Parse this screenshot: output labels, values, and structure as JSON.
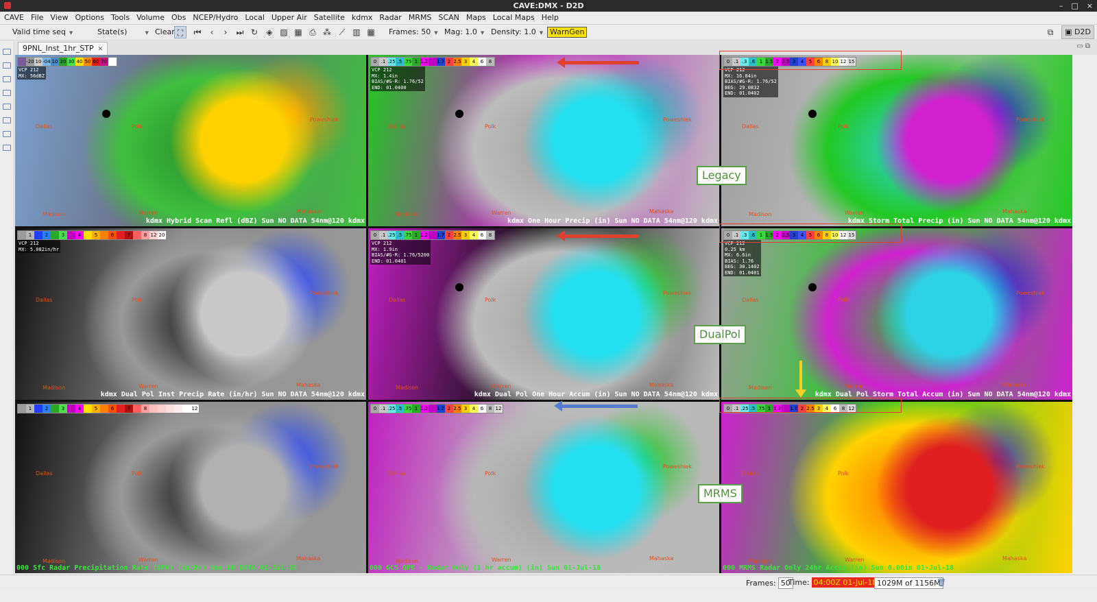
{
  "window": {
    "title": "CAVE:DMX - D2D"
  },
  "menu": [
    "CAVE",
    "File",
    "View",
    "Options",
    "Tools",
    "Volume",
    "Obs",
    "NCEP/Hydro",
    "Local",
    "Upper Air",
    "Satellite",
    "kdmx",
    "Radar",
    "MRMS",
    "SCAN",
    "Maps",
    "Local Maps",
    "Help"
  ],
  "toolbar": {
    "valid_time": "Valid time seq",
    "states": "State(s)",
    "clear": "Clear",
    "frames": "Frames: 50",
    "mag": "Mag: 1.0",
    "density": "Density: 1.0",
    "warngen": "WarnGen",
    "perspective": "D2D"
  },
  "tab": {
    "label": "9PNL_Inst_1hr_STP"
  },
  "labels": {
    "legacy": "Legacy",
    "dualpol": "DualPol",
    "mrms": "MRMS"
  },
  "panes": [
    {
      "legend": "kdmx Hybrid Scan Refl (dBZ)  Sun  NO DATA 54nm@120 kdmx",
      "info": [
        "VCP 212",
        "MX: 56dBZ"
      ],
      "ticks": [
        "",
        "-20",
        "10",
        "-04",
        "10",
        "20",
        "30",
        "40",
        "50",
        "60",
        "70",
        ""
      ],
      "colors": [
        "#7a5a9a",
        "#9a9a9a",
        "#cfcfcf",
        "#7ab6e6",
        "#4a8ac6",
        "#2aa02a",
        "#4ae04a",
        "#ffe000",
        "#ff8a00",
        "#e02020",
        "#c01880",
        "#ffffff"
      ]
    },
    {
      "legend": "kdmx One Hour Precip (in)  Sun  NO DATA 54nm@120 kdmx",
      "info": [
        "VCP 212",
        "MX: 1.4in",
        "BIAS/#G-R: 1.76/52",
        "END: 01.0400"
      ],
      "ticks": [
        "0",
        ".1",
        ".25",
        ".5",
        ".75",
        "1",
        "1.25",
        "",
        "1.75",
        "2",
        "2.5",
        "3",
        "4",
        "6",
        "8"
      ],
      "colors": [
        "#aaaaaa",
        "#c8c8c8",
        "#6ae8ea",
        "#2ac0c8",
        "#3ad83a",
        "#2aa82a",
        "#ff00ff",
        "#c000c0",
        "#2040d0",
        "#ff4040",
        "#ff8000",
        "#ffd000",
        "#ffff60",
        "#ffffff",
        "#bbbbbb"
      ]
    },
    {
      "legend": "kdmx Storm Total Precip (in)  Sun  NO DATA 54nm@120 kdmx",
      "info": [
        "VCP 212",
        "MX: 16.84in",
        "BIAS/#G-R: 1.76/52",
        "BEG: 29.0832",
        "END: 01.0402"
      ],
      "ticks": [
        "0",
        ".1",
        ".3",
        ".6",
        "1",
        "1.5",
        "2",
        "2.5",
        "3",
        "4",
        "5",
        "6",
        "8",
        "10",
        "12",
        "15"
      ],
      "colors": [
        "#aaaaaa",
        "#c8c8c8",
        "#6ae8ea",
        "#2ac0c8",
        "#3ad83a",
        "#2aa82a",
        "#ff00ff",
        "#c000c0",
        "#2040d0",
        "#4050ff",
        "#ff4040",
        "#ff8000",
        "#ffd000",
        "#ffff60",
        "#ffffff",
        "#dddddd"
      ]
    },
    {
      "legend": "kdmx Dual Pol Inst Precip Rate (in/hr)  Sun  NO DATA 54nm@120 kdmx",
      "info": [
        "VCP 212",
        "MX: 5.082in/hr"
      ],
      "ticks": [
        "",
        "1",
        "",
        "2",
        "",
        "3",
        "",
        "4",
        "",
        "5",
        "",
        "6",
        "",
        "7",
        "",
        "8",
        "12",
        "20"
      ],
      "colors": [
        "#9a9a9a",
        "#b5b5b5",
        "#2040ff",
        "#2a80ff",
        "#2aa82a",
        "#4ae04a",
        "#c000c0",
        "#ff00ff",
        "#ffe000",
        "#ffb000",
        "#ff8000",
        "#ff5000",
        "#e02020",
        "#b01010",
        "#ff6060",
        "#ffa0a0",
        "#ffd0d0",
        "#ffffff"
      ]
    },
    {
      "legend": "kdmx Dual Pol One Hour Accum (in)  Sun  NO DATA 54nm@120 kdmx",
      "info": [
        "VCP 212",
        "MX: 1.9in",
        "BIAS/#G-R: 1.76/5200",
        "END: 01.0401"
      ],
      "ticks": [
        "0",
        ".1",
        ".25",
        ".5",
        ".75",
        "1",
        "1.25",
        "",
        "1.75",
        "2",
        "2.5",
        "3",
        "4",
        "6",
        "8"
      ],
      "colors": [
        "#aaaaaa",
        "#c8c8c8",
        "#6ae8ea",
        "#2ac0c8",
        "#3ad83a",
        "#2aa82a",
        "#ff00ff",
        "#c000c0",
        "#2040d0",
        "#ff4040",
        "#ff8000",
        "#ffd000",
        "#ffff60",
        "#ffffff",
        "#bbbbbb"
      ]
    },
    {
      "legend": "kdmx Dual Pol Storm Total Accum (in)  Sun  NO DATA 54nm@120 kdmx",
      "info": [
        "VCP 212",
        "0.25 km",
        "MX: 6.6in",
        "BIAS: 1.76",
        "BEG: 30.1402",
        "END: 01.0401"
      ],
      "ticks": [
        "0",
        ".1",
        ".3",
        ".6",
        "1",
        "1.5",
        "2",
        "2.5",
        "3",
        "4",
        "5",
        "6",
        "8",
        "10",
        "12",
        "15"
      ],
      "colors": [
        "#aaaaaa",
        "#c8c8c8",
        "#6ae8ea",
        "#2ac0c8",
        "#3ad83a",
        "#2aa82a",
        "#ff00ff",
        "#c000c0",
        "#2040d0",
        "#4050ff",
        "#ff4040",
        "#ff8000",
        "#ffd000",
        "#ffff60",
        "#ffffff",
        "#dddddd"
      ]
    },
    {
      "legend": "000 Sfc Radar Precipitation Rate (SPR) (in/hr)  Sun  NO DATA 01-Jul-18",
      "info": [],
      "ticks": [
        "",
        "1",
        "",
        "2",
        "",
        "3",
        "",
        "4",
        "",
        "5",
        "",
        "6",
        "",
        "7",
        "",
        "8",
        "",
        "",
        "",
        "",
        "",
        "12"
      ],
      "colors": [
        "#9a9a9a",
        "#b5b5b5",
        "#2040ff",
        "#2a80ff",
        "#2aa82a",
        "#4ae04a",
        "#c000c0",
        "#ff00ff",
        "#ffe000",
        "#ffb000",
        "#ff8000",
        "#ff5000",
        "#e02020",
        "#b01010",
        "#ff6060",
        "#ffa0a0",
        "#ffc0c0",
        "#ffd0d0",
        "#ffe0e0",
        "#ffeeee",
        "#ffffff",
        "#ffffff"
      ]
    },
    {
      "legend": "000 GCS QPE - Radar Only (1 hr accum) (in)  Sun  01-Jul-18",
      "info": [],
      "ticks": [
        "0",
        ".1",
        ".25",
        ".5",
        ".75",
        "1",
        "1.25",
        "",
        "1.75",
        "2",
        "2.5",
        "3",
        "4",
        "6",
        "8",
        "12"
      ],
      "colors": [
        "#aaaaaa",
        "#c8c8c8",
        "#6ae8ea",
        "#2ac0c8",
        "#3ad83a",
        "#2aa82a",
        "#ff00ff",
        "#c000c0",
        "#2040d0",
        "#ff4040",
        "#ff8000",
        "#ffd000",
        "#ffff60",
        "#ffffff",
        "#bbbbbb",
        "#dddddd"
      ]
    },
    {
      "legend": "000 MRMS Radar Only 24hr Accum (in)  Sun  0.00in  01-Jul-18",
      "info": [],
      "ticks": [
        "0",
        ".1",
        ".25",
        ".5",
        ".75",
        "1",
        "1.25",
        "",
        "1.75",
        "2",
        "2.5",
        "3",
        "4",
        "6",
        "8",
        "12"
      ],
      "colors": [
        "#aaaaaa",
        "#c8c8c8",
        "#6ae8ea",
        "#2ac0c8",
        "#3ad83a",
        "#2aa82a",
        "#ff00ff",
        "#c000c0",
        "#2040d0",
        "#ff4040",
        "#ff8000",
        "#ffd000",
        "#ffff60",
        "#ffffff",
        "#bbbbbb",
        "#dddddd"
      ]
    }
  ],
  "counties": {
    "dallas": "Dallas",
    "polk": "Polk",
    "poweshiek": "Poweshiek",
    "madison": "Madison",
    "warren": "Warren",
    "mahaska": "Mahaska"
  },
  "status": {
    "frames_label": "Frames:",
    "frames_value": "50",
    "time_label": "Time:",
    "time_value": "04:00Z 01-Jul-18",
    "memory": "1029M of 1156M"
  }
}
